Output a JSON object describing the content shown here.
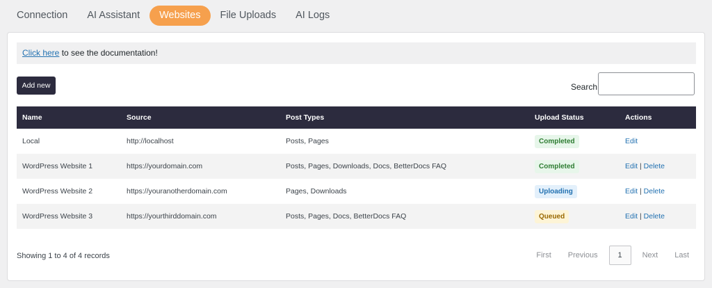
{
  "tabs": [
    {
      "label": "Connection",
      "active": false
    },
    {
      "label": "AI Assistant",
      "active": false
    },
    {
      "label": "Websites",
      "active": true
    },
    {
      "label": "File Uploads",
      "active": false
    },
    {
      "label": "AI Logs",
      "active": false
    }
  ],
  "notice": {
    "link_text": "Click here",
    "text": " to see the documentation!"
  },
  "toolbar": {
    "add_label": "Add new",
    "search_label": "Search:",
    "search_value": ""
  },
  "table": {
    "headers": [
      "Name",
      "Source",
      "Post Types",
      "Upload Status",
      "Actions"
    ],
    "rows": [
      {
        "name": "Local",
        "source": "http://localhost",
        "post_types": "Posts, Pages",
        "status": "Completed",
        "status_kind": "completed",
        "actions": [
          "Edit"
        ]
      },
      {
        "name": "WordPress Website 1",
        "source": "https://yourdomain.com",
        "post_types": "Posts, Pages, Downloads, Docs, BetterDocs FAQ",
        "status": "Completed",
        "status_kind": "completed",
        "actions": [
          "Edit",
          "Delete"
        ]
      },
      {
        "name": "WordPress Website 2",
        "source": "https://youranotherdomain.com",
        "post_types": "Pages, Downloads",
        "status": "Uploading",
        "status_kind": "uploading",
        "actions": [
          "Edit",
          "Delete"
        ]
      },
      {
        "name": "WordPress Website 3",
        "source": "https://yourthirddomain.com",
        "post_types": "Posts, Pages, Docs, BetterDocs FAQ",
        "status": "Queued",
        "status_kind": "queued",
        "actions": [
          "Edit",
          "Delete"
        ]
      }
    ],
    "action_separator": "|"
  },
  "footer": {
    "showing": "Showing 1 to 4 of 4 records",
    "pager": {
      "first": "First",
      "previous": "Previous",
      "current": "1",
      "next": "Next",
      "last": "Last"
    }
  },
  "colors": {
    "accent": "#f6a04d",
    "header_bg": "#2c2b3e",
    "link": "#2271b1"
  }
}
